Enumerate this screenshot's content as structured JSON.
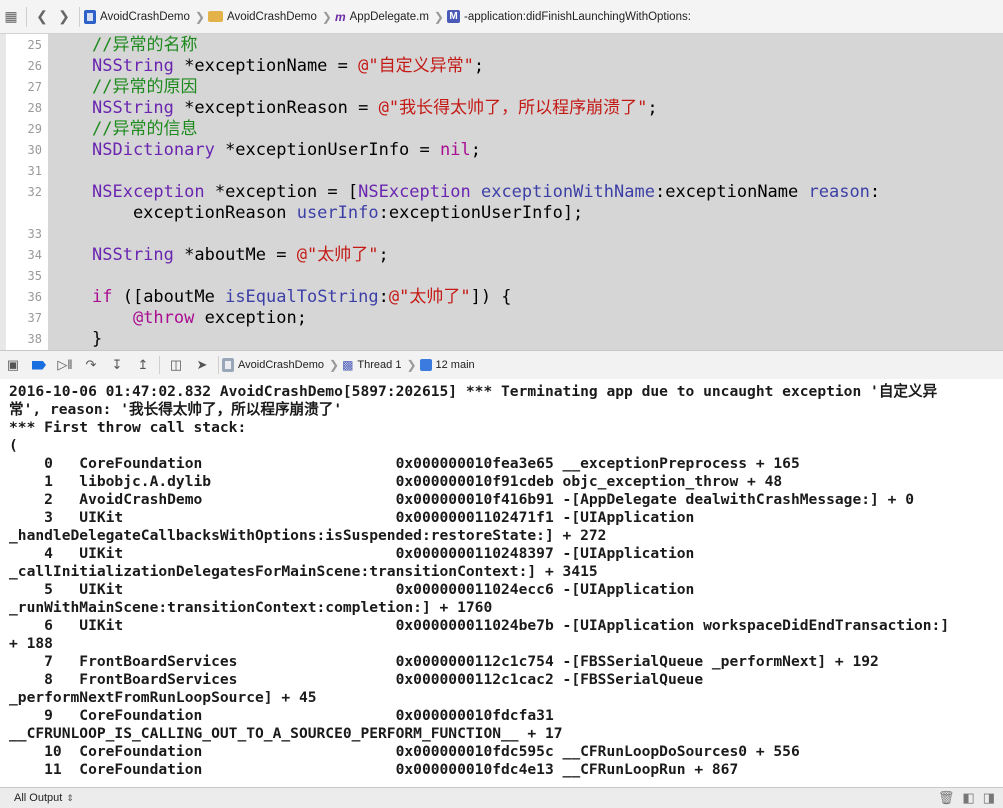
{
  "jumpbar": {
    "crumbs": [
      "AvoidCrashDemo",
      "AvoidCrashDemo",
      "AppDelegate.m",
      "-application:didFinishLaunchingWithOptions:"
    ]
  },
  "editor": {
    "line_numbers": [
      "25",
      "26",
      "27",
      "28",
      "29",
      "30",
      "31",
      "32",
      "",
      "33",
      "34",
      "35",
      "36",
      "37",
      "38"
    ],
    "lines": [
      "//异常的名称",
      "NSString *exceptionName = @\"自定义异常\";",
      "//异常的原因",
      "NSString *exceptionReason = @\"我长得太帅了，所以程序崩溃了\";",
      "//异常的信息",
      "NSDictionary *exceptionUserInfo = nil;",
      "",
      "NSException *exception = [NSException exceptionWithName:exceptionName reason:",
      "    exceptionReason userInfo:exceptionUserInfo];",
      "",
      "NSString *aboutMe = @\"太帅了\";",
      "",
      "if ([aboutMe isEqualToString:@\"太帅了\"]) {",
      "    @throw exception;",
      "}"
    ]
  },
  "debugbar": {
    "target": "AvoidCrashDemo",
    "thread": "Thread 1",
    "frame": "12 main"
  },
  "console": {
    "lines": [
      "2016-10-06 01:47:02.832 AvoidCrashDemo[5897:202615] *** Terminating app due to uncaught exception '自定义异",
      "常', reason: '我长得太帅了，所以程序崩溃了'",
      "*** First throw call stack:",
      "(",
      "    0   CoreFoundation                      0x000000010fea3e65 __exceptionPreprocess + 165",
      "    1   libobjc.A.dylib                     0x000000010f91cdeb objc_exception_throw + 48",
      "    2   AvoidCrashDemo                      0x000000010f416b91 -[AppDelegate dealwithCrashMessage:] + 0",
      "    3   UIKit                               0x00000001102471f1 -[UIApplication",
      "_handleDelegateCallbacksWithOptions:isSuspended:restoreState:] + 272",
      "    4   UIKit                               0x0000000110248397 -[UIApplication",
      "_callInitializationDelegatesForMainScene:transitionContext:] + 3415",
      "    5   UIKit                               0x000000011024ecc6 -[UIApplication",
      "_runWithMainScene:transitionContext:completion:] + 1760",
      "    6   UIKit                               0x000000011024be7b -[UIApplication workspaceDidEndTransaction:]",
      "+ 188",
      "    7   FrontBoardServices                  0x0000000112c1c754 -[FBSSerialQueue _performNext] + 192",
      "    8   FrontBoardServices                  0x0000000112c1cac2 -[FBSSerialQueue",
      "_performNextFromRunLoopSource] + 45",
      "    9   CoreFoundation                      0x000000010fdcfa31",
      "__CFRUNLOOP_IS_CALLING_OUT_TO_A_SOURCE0_PERFORM_FUNCTION__ + 17",
      "    10  CoreFoundation                      0x000000010fdc595c __CFRunLoopDoSources0 + 556",
      "    11  CoreFoundation                      0x000000010fdc4e13 __CFRunLoopRun + 867"
    ]
  },
  "bottombar": {
    "filter": "All Output"
  },
  "colors": {
    "comment": "#1d8a1d",
    "type": "#6a25b0",
    "string": "#c41a16",
    "keyword": "#a90d91",
    "accent": "#1a6fe0"
  }
}
